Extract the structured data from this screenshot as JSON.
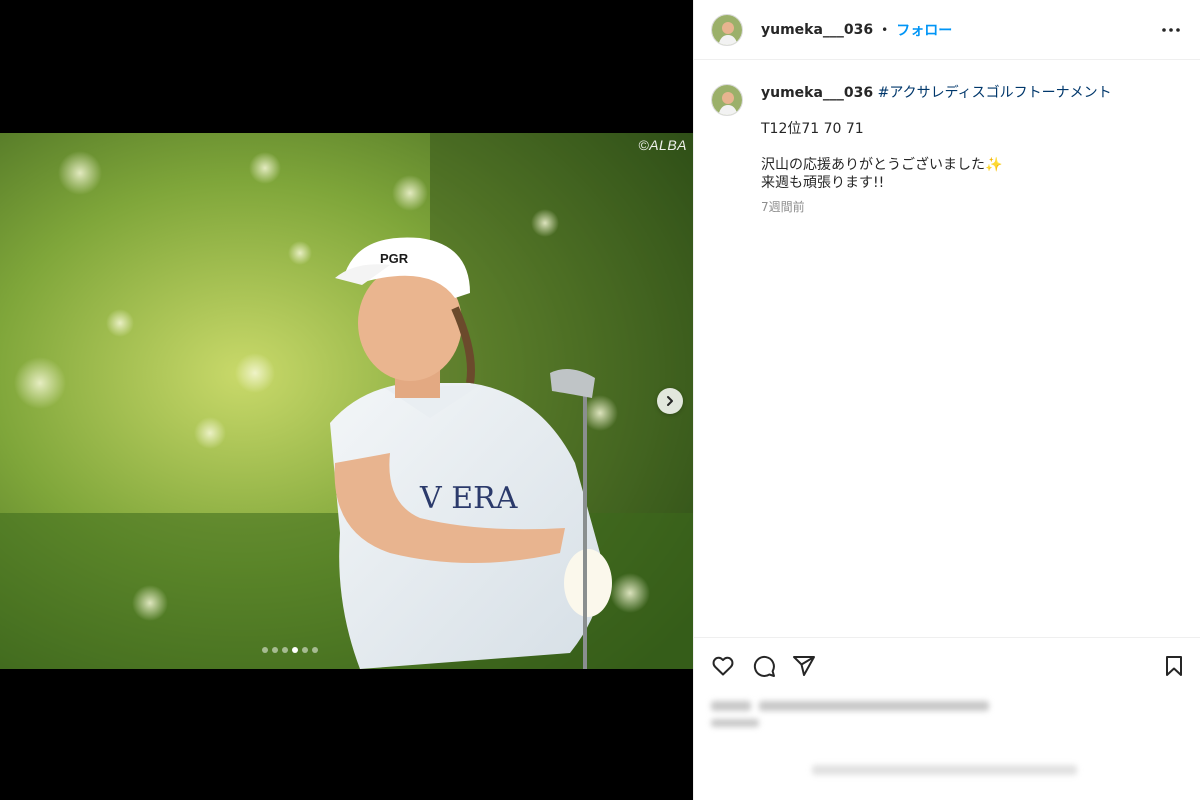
{
  "post": {
    "watermark": "©ALBA",
    "carousel": {
      "total": 6,
      "active": 3
    }
  },
  "header": {
    "username": "yumeka___036",
    "separator": "•",
    "follow_label": "フォロー"
  },
  "caption": {
    "username": "yumeka___036",
    "hashtag": "#アクサレディスゴルフトーナメント",
    "line1": "T12位71 70 71",
    "line2": "沢山の応援ありがとうございました",
    "line2_emoji": "✨",
    "line3": "来週も頑張ります!!",
    "timestamp": "7週間前"
  },
  "icons": {
    "next": "chevron-right-icon",
    "more": "more-options-icon",
    "like": "heart-icon",
    "comment": "comment-icon",
    "share": "share-icon",
    "save": "bookmark-icon"
  },
  "colors": {
    "accent": "#0095f6",
    "hashtag": "#00376b",
    "text": "#262626",
    "muted": "#8e8e8e"
  }
}
